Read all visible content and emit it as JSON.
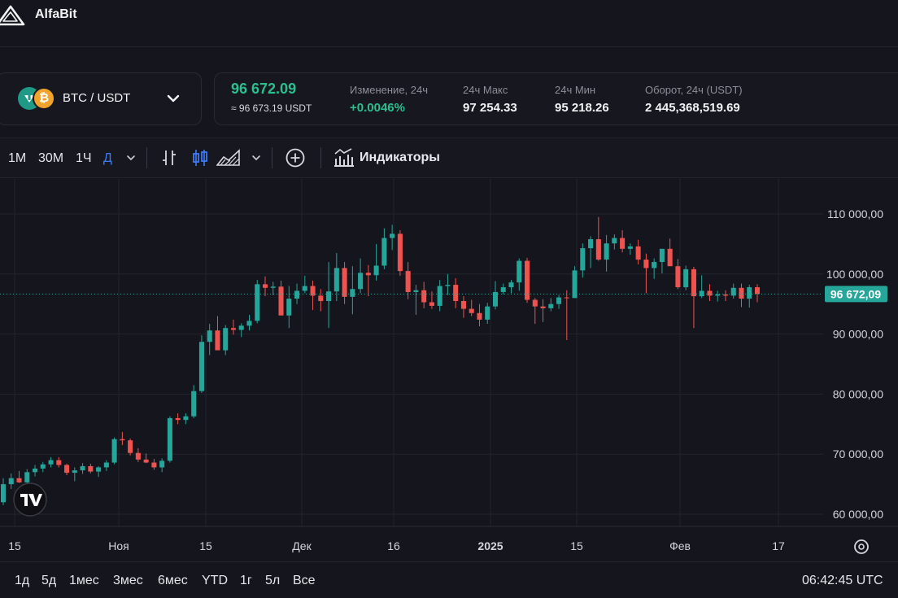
{
  "app": {
    "brand": "AlfaBit"
  },
  "pair": {
    "label": "BTC / USDT",
    "btc_glyph": "₿"
  },
  "ticker": {
    "price": "96 672.09",
    "price_approx": "≈ 96 673.19 USDT",
    "stats": [
      {
        "label": "Изменение, 24ч",
        "value": "+0.0046%",
        "positive": true
      },
      {
        "label": "24ч Макс",
        "value": "97 254.33"
      },
      {
        "label": "24ч Мин",
        "value": "95 218.26"
      },
      {
        "label": "Оборот, 24ч (USDT)",
        "value": "2 445,368,519.69"
      }
    ]
  },
  "toolbar": {
    "timeframes": [
      "1М",
      "30М",
      "1Ч",
      "Д"
    ],
    "active_timeframe": "Д",
    "indicators_label": "Индикаторы"
  },
  "colors": {
    "up": "#26a69a",
    "down": "#ef5350",
    "accent": "#3d7bf5",
    "bg": "#15151d"
  },
  "chart_data": {
    "type": "candlestick",
    "y_ticks": [
      "110 000,00",
      "100 000,00",
      "90 000,00",
      "80 000,00",
      "70 000,00",
      "60 000,00"
    ],
    "y_tick_values": [
      110000,
      100000,
      90000,
      80000,
      70000,
      60000
    ],
    "x_ticks": [
      "15",
      "Ноя",
      "15",
      "Дек",
      "16",
      "2025",
      "15",
      "Фев",
      "17"
    ],
    "current_price_label": "96 672,09",
    "current_price": 96672,
    "ylim": [
      58000,
      112500
    ],
    "candles": [
      [
        62000,
        66000,
        61500,
        65000
      ],
      [
        65000,
        66800,
        64200,
        66000
      ],
      [
        66000,
        67200,
        65200,
        65300
      ],
      [
        65300,
        67500,
        65000,
        67000
      ],
      [
        67000,
        68200,
        66300,
        67600
      ],
      [
        67600,
        68700,
        67000,
        68300
      ],
      [
        68300,
        69500,
        67800,
        69000
      ],
      [
        69000,
        69500,
        67800,
        68200
      ],
      [
        68200,
        68400,
        66500,
        66900
      ],
      [
        66900,
        67800,
        65500,
        67300
      ],
      [
        67300,
        68500,
        66700,
        68000
      ],
      [
        68000,
        68400,
        66800,
        67100
      ],
      [
        67100,
        68000,
        66200,
        67800
      ],
      [
        67800,
        69000,
        67200,
        68600
      ],
      [
        68600,
        72800,
        68300,
        72500
      ],
      [
        72500,
        73700,
        71500,
        72300
      ],
      [
        72300,
        72600,
        69800,
        70200
      ],
      [
        70200,
        71000,
        68700,
        69100
      ],
      [
        69100,
        70100,
        68500,
        68600
      ],
      [
        68600,
        69200,
        67400,
        67800
      ],
      [
        67800,
        69300,
        67000,
        68900
      ],
      [
        68900,
        76300,
        68600,
        76000
      ],
      [
        76000,
        76800,
        75000,
        75700
      ],
      [
        75700,
        76800,
        75000,
        76300
      ],
      [
        76300,
        81500,
        76000,
        80500
      ],
      [
        80500,
        89800,
        80200,
        88700
      ],
      [
        88700,
        91700,
        86500,
        90600
      ],
      [
        90600,
        93000,
        88600,
        87300
      ],
      [
        87300,
        91500,
        86500,
        91000
      ],
      [
        91000,
        92400,
        89900,
        90700
      ],
      [
        90700,
        91800,
        89500,
        91400
      ],
      [
        91400,
        93200,
        90600,
        92200
      ],
      [
        92200,
        99000,
        91800,
        98300
      ],
      [
        98300,
        99600,
        96300,
        97700
      ],
      [
        97700,
        98700,
        96500,
        97900
      ],
      [
        97900,
        98900,
        95000,
        93100
      ],
      [
        93100,
        98000,
        91000,
        95900
      ],
      [
        95900,
        98400,
        95000,
        97200
      ],
      [
        97200,
        99700,
        96800,
        98000
      ],
      [
        98000,
        98900,
        94000,
        96400
      ],
      [
        96400,
        97500,
        93800,
        95500
      ],
      [
        95500,
        102000,
        91000,
        97100
      ],
      [
        97100,
        103500,
        95500,
        101000
      ],
      [
        101000,
        102000,
        95000,
        96200
      ],
      [
        96200,
        101300,
        93300,
        97500
      ],
      [
        97500,
        102600,
        96800,
        100200
      ],
      [
        100200,
        101500,
        96300,
        99800
      ],
      [
        99800,
        105000,
        98900,
        101400
      ],
      [
        101400,
        107600,
        100800,
        106000
      ],
      [
        106000,
        108200,
        104000,
        106700
      ],
      [
        106700,
        107300,
        99700,
        100500
      ],
      [
        100500,
        102000,
        95800,
        97000
      ],
      [
        97000,
        98200,
        93200,
        97300
      ],
      [
        97300,
        98700,
        94300,
        95300
      ],
      [
        95300,
        97100,
        94200,
        94700
      ],
      [
        94700,
        99000,
        93800,
        98000
      ],
      [
        98000,
        100000,
        96500,
        98200
      ],
      [
        98200,
        99300,
        94300,
        95500
      ],
      [
        95500,
        96300,
        92700,
        94200
      ],
      [
        94200,
        95700,
        93000,
        93500
      ],
      [
        93500,
        95000,
        91300,
        92400
      ],
      [
        92400,
        95200,
        91700,
        94600
      ],
      [
        94600,
        98800,
        94100,
        97000
      ],
      [
        97000,
        98400,
        96600,
        97800
      ],
      [
        97800,
        99000,
        96800,
        98600
      ],
      [
        98600,
        102600,
        97200,
        102200
      ],
      [
        102200,
        102700,
        95200,
        95700
      ],
      [
        95700,
        96000,
        91700,
        94600
      ],
      [
        94600,
        95800,
        92000,
        94300
      ],
      [
        94300,
        96000,
        93800,
        95000
      ],
      [
        95000,
        96500,
        94200,
        96100
      ],
      [
        96100,
        97300,
        89000,
        96000
      ],
      [
        96000,
        101300,
        96000,
        100600
      ],
      [
        100600,
        105100,
        99400,
        104300
      ],
      [
        104300,
        106300,
        101000,
        105800
      ],
      [
        105800,
        109500,
        102200,
        102400
      ],
      [
        102400,
        106500,
        100400,
        105100
      ],
      [
        105100,
        106600,
        104100,
        106000
      ],
      [
        106000,
        107300,
        103600,
        104200
      ],
      [
        104200,
        105100,
        103200,
        104600
      ],
      [
        104600,
        105700,
        101600,
        102400
      ],
      [
        102400,
        103400,
        96800,
        101000
      ],
      [
        101000,
        102600,
        99200,
        102000
      ],
      [
        102000,
        103300,
        100100,
        104200
      ],
      [
        104200,
        105900,
        102600,
        101300
      ],
      [
        101300,
        102500,
        97500,
        97800
      ],
      [
        97800,
        101400,
        97300,
        100800
      ],
      [
        100800,
        101200,
        91000,
        96300
      ],
      [
        96300,
        99800,
        96000,
        97200
      ],
      [
        97200,
        98300,
        95500,
        96400
      ],
      [
        96400,
        97200,
        95400,
        96600
      ],
      [
        96600,
        97300,
        95500,
        96400
      ],
      [
        96400,
        98400,
        95900,
        97700
      ],
      [
        97700,
        98400,
        94500,
        95900
      ],
      [
        95900,
        98200,
        94400,
        97800
      ],
      [
        97800,
        98300,
        95300,
        96672
      ]
    ]
  },
  "range_buttons": [
    "1д",
    "5д",
    "1мес",
    "3мес",
    "6мес",
    "YTD",
    "1г",
    "5л",
    "Все"
  ],
  "clock": "06:42:45 UTC"
}
